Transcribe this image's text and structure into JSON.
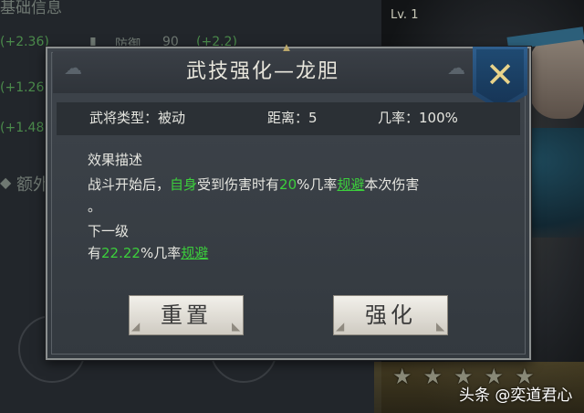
{
  "background": {
    "header_text": "基础信息",
    "rows": [
      {
        "bonus": "(+2.36)"
      },
      {
        "bonus": "(+1.26"
      },
      {
        "bonus": "(+1.48"
      }
    ],
    "defense_label": "防御",
    "defense_value": "90",
    "defense_bonus": "(+2.2)",
    "extra_label": "额外",
    "hero_level": "Lv. 1"
  },
  "dialog": {
    "title": "武技强化—龙胆",
    "stats": {
      "type": "武将类型：被动",
      "distance": "距离：5",
      "chance": "几率：100%"
    },
    "effect_label": "效果描述",
    "effect_text": {
      "p1": "战斗开始后，",
      "p2": "自身",
      "p3": "受到伤害时有",
      "p4": "20",
      "p5": "%几率",
      "p6": "规避",
      "p7": "本次伤害",
      "p8": "。"
    },
    "next_label": "下一级",
    "next_text": {
      "p1": "有",
      "p2": "22.22",
      "p3": "%几率",
      "p4": "规避"
    },
    "reset_button": "重置",
    "enhance_button": "强化"
  },
  "hero": {
    "stars": [
      "★",
      "★",
      "★",
      "★",
      "★"
    ]
  },
  "watermark": "头条 @奕道君心"
}
